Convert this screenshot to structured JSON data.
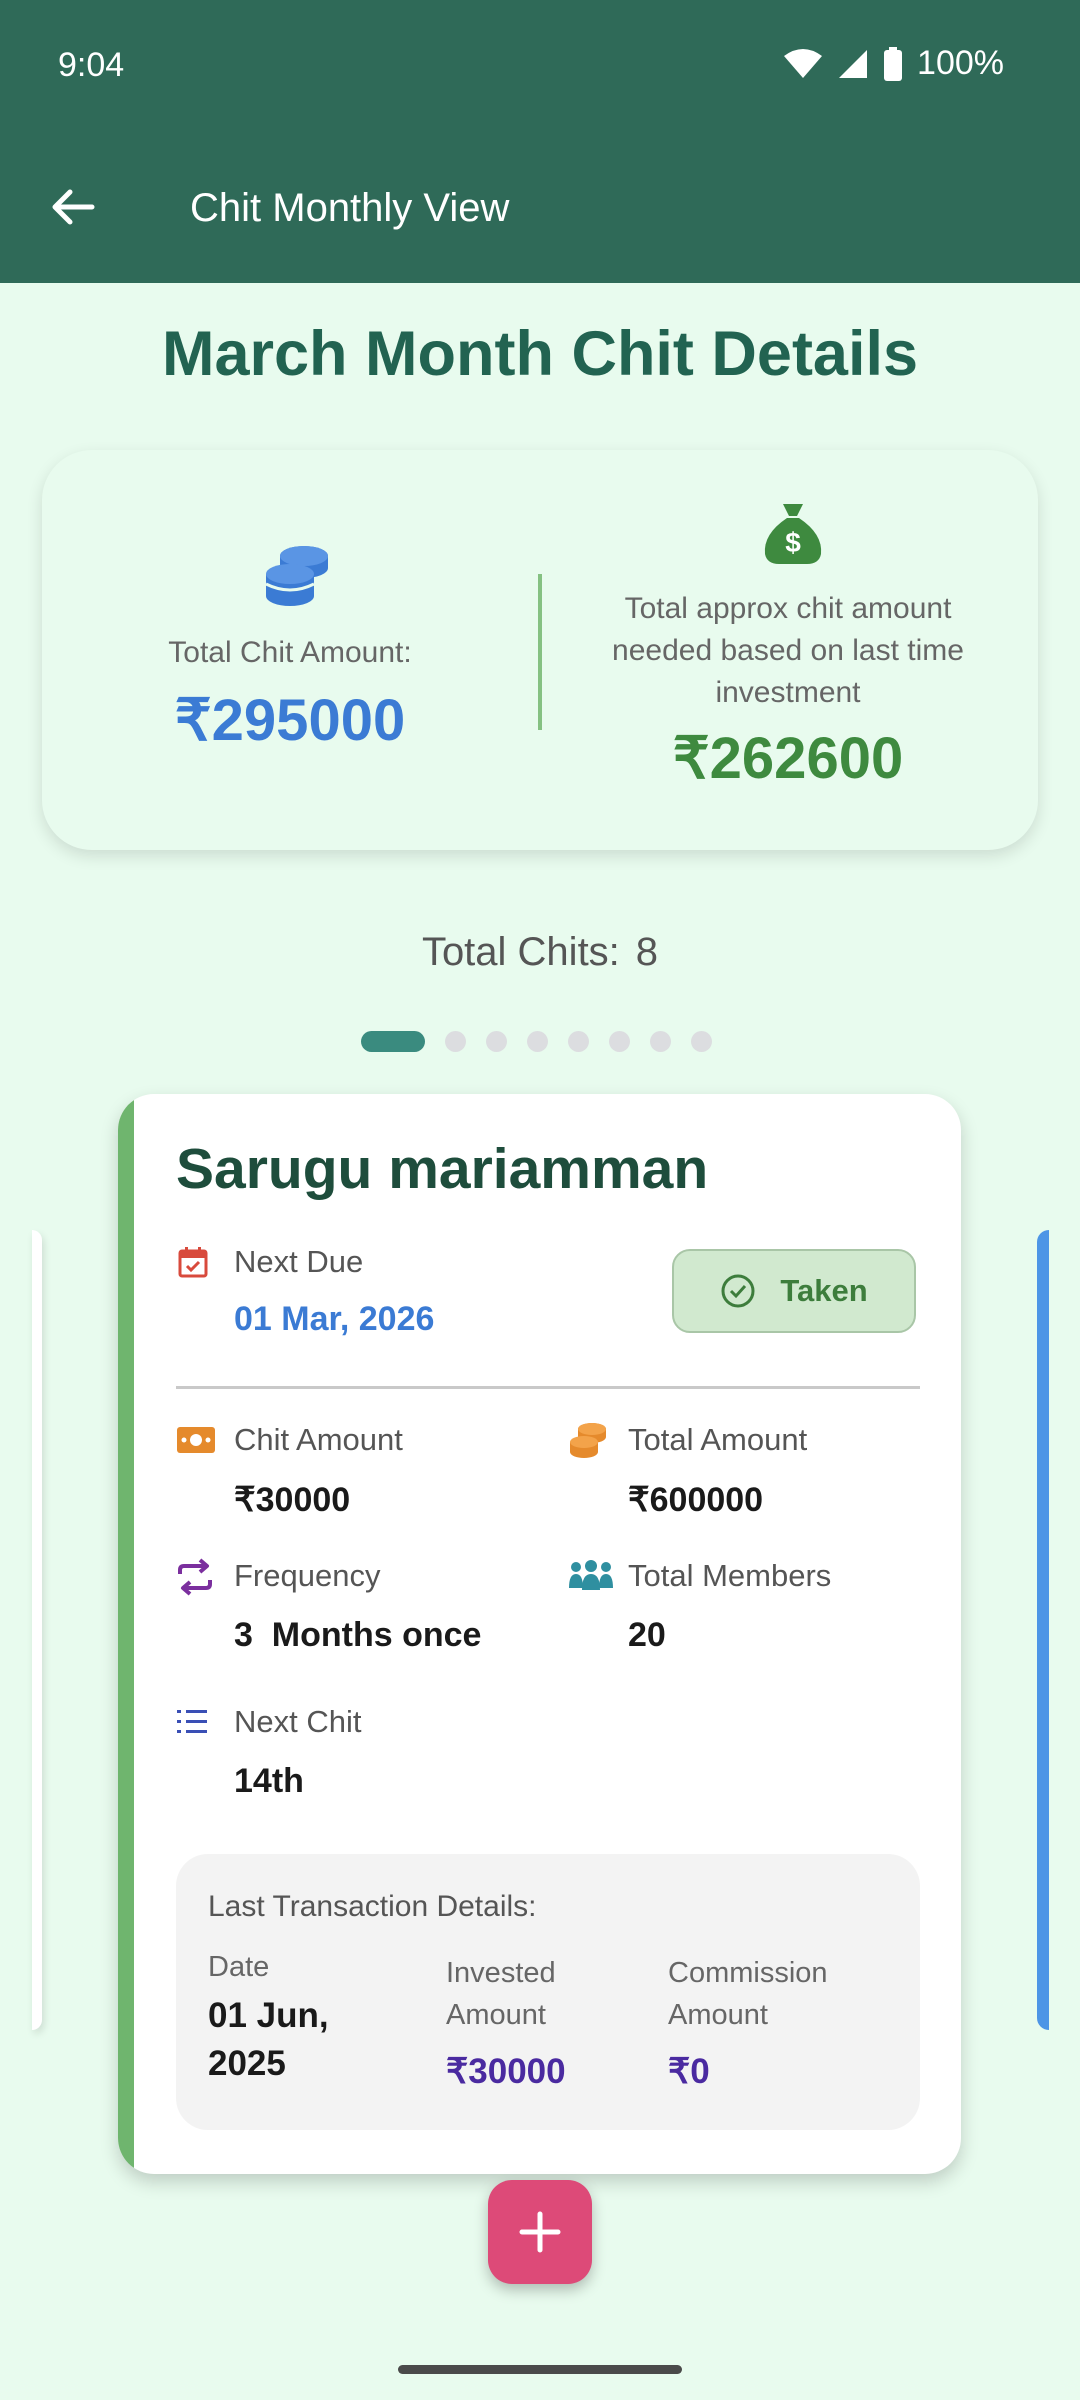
{
  "status_bar": {
    "time": "9:04",
    "battery": "100%"
  },
  "app_bar": {
    "title": "Chit Monthly View",
    "back_icon": "arrow-left-icon"
  },
  "heading": "March Month Chit Details",
  "summary": {
    "total_label": "Total Chit Amount:",
    "total_value": "₹295000",
    "approx_label": "Total approx chit amount needed based on last time investment",
    "approx_value": "₹262600",
    "colors": {
      "total": "#3b7bd4",
      "approx": "#3e8a3f"
    }
  },
  "total_chits": {
    "label": "Total Chits:",
    "value": "8"
  },
  "pager": {
    "count": 8,
    "active_index": 0
  },
  "chit": {
    "name": "Sarugu mariamman",
    "next_due_label": "Next Due",
    "next_due_value": "01 Mar, 2026",
    "status_label": "Taken",
    "chit_amount_label": "Chit Amount",
    "chit_amount_value": "₹30000",
    "total_amount_label": "Total Amount",
    "total_amount_value": "₹600000",
    "frequency_label": "Frequency",
    "frequency_value": "3  Months once",
    "total_members_label": "Total Members",
    "total_members_value": "20",
    "next_chit_label": "Next Chit",
    "next_chit_value": "14th",
    "last_txn": {
      "title": "Last Transaction Details:",
      "date_label": "Date",
      "date_line1": "01 Jun,",
      "date_line2": "2025",
      "invested_label_1": "Invested",
      "invested_label_2": "Amount",
      "invested_value": "₹30000",
      "commission_label_1": "Commission",
      "commission_label_2": "Amount",
      "commission_value": "₹0"
    }
  },
  "fab": {
    "icon": "plus-icon"
  }
}
